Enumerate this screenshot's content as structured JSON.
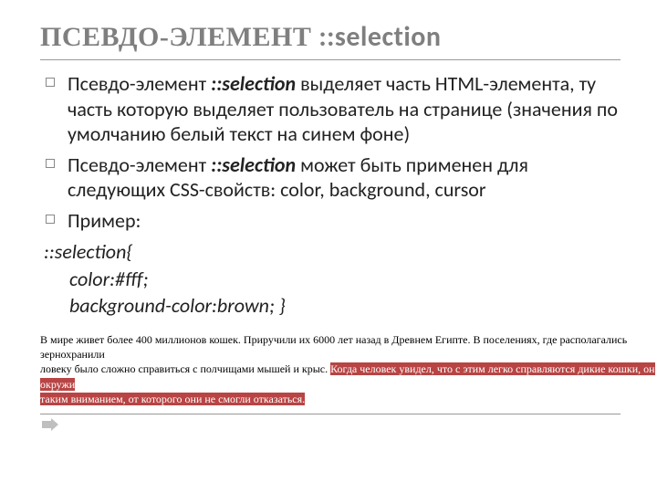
{
  "title_prefix": "ПСЕВДО-ЭЛЕМЕНТ  ",
  "title_sel": "::selection",
  "bullets": {
    "b1_pre": "Псевдо-элемент ",
    "b1_kw": "::selection",
    "b1_post": " выделяет часть HTML-элемента, ту часть которую выделяет пользователь на странице (значения по умолчанию белый текст на синем фоне)",
    "b2_pre": "Псевдо-элемент  ",
    "b2_kw": "::selection",
    "b2_post": " может быть применен для следующих CSS-свойств: color, background, cursor",
    "b3": "Пример:"
  },
  "code": {
    "l1": "::selection{",
    "l2": "color:#fff;",
    "l3": "background-color:brown; }"
  },
  "example": {
    "plain_part1": "В мире живет более 400 миллионов кошек. Приручили их 6000 лет назад в Древнем Египте. В поселениях, где располагались зернохранили",
    "plain_part2": "ловеку было сложно справиться с полчищами мышей и крыс. ",
    "highlight1": "Когда человек увидел, что с этим легко справляются дикие кошки, он окружи",
    "highlight2": "таким вниманием, от которого они не смогли отказаться."
  }
}
